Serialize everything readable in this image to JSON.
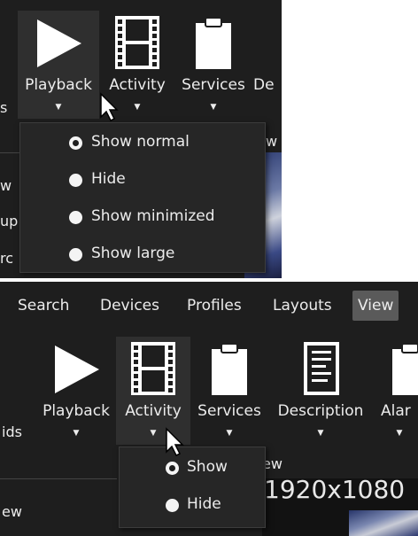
{
  "panel1": {
    "ribbon": [
      {
        "label": "Playback",
        "icon": "play-icon"
      },
      {
        "label": "Activity",
        "icon": "film-icon"
      },
      {
        "label": "Services",
        "icon": "clipboard-icon"
      },
      {
        "label": "De",
        "icon": "document-icon"
      }
    ],
    "left_fragments": [
      "s",
      "w",
      "up",
      "rc"
    ],
    "right_fragment": "w",
    "menu": {
      "options": [
        "Show normal",
        "Hide",
        "Show minimized",
        "Show large"
      ],
      "selected": "Show normal"
    }
  },
  "panel2": {
    "tabs": [
      "Search",
      "Devices",
      "Profiles",
      "Layouts",
      "View"
    ],
    "active_tab": "View",
    "ribbon": [
      {
        "label": "Playback",
        "icon": "play-icon"
      },
      {
        "label": "Activity",
        "icon": "film-icon"
      },
      {
        "label": "Services",
        "icon": "clipboard-icon"
      },
      {
        "label": "Description",
        "icon": "document-icon"
      },
      {
        "label": "Alar",
        "icon": "clipboard-icon"
      }
    ],
    "left_fragments": [
      "ids",
      "ew"
    ],
    "right_fragment": "ew",
    "resolution_text": "1920x1080",
    "menu": {
      "options": [
        "Show",
        "Hide"
      ],
      "selected": "Show"
    }
  },
  "colors": {
    "background": "#1e1e1e",
    "menu": "#262626",
    "active_tab": "#5a5a5a",
    "text": "#ececec"
  }
}
